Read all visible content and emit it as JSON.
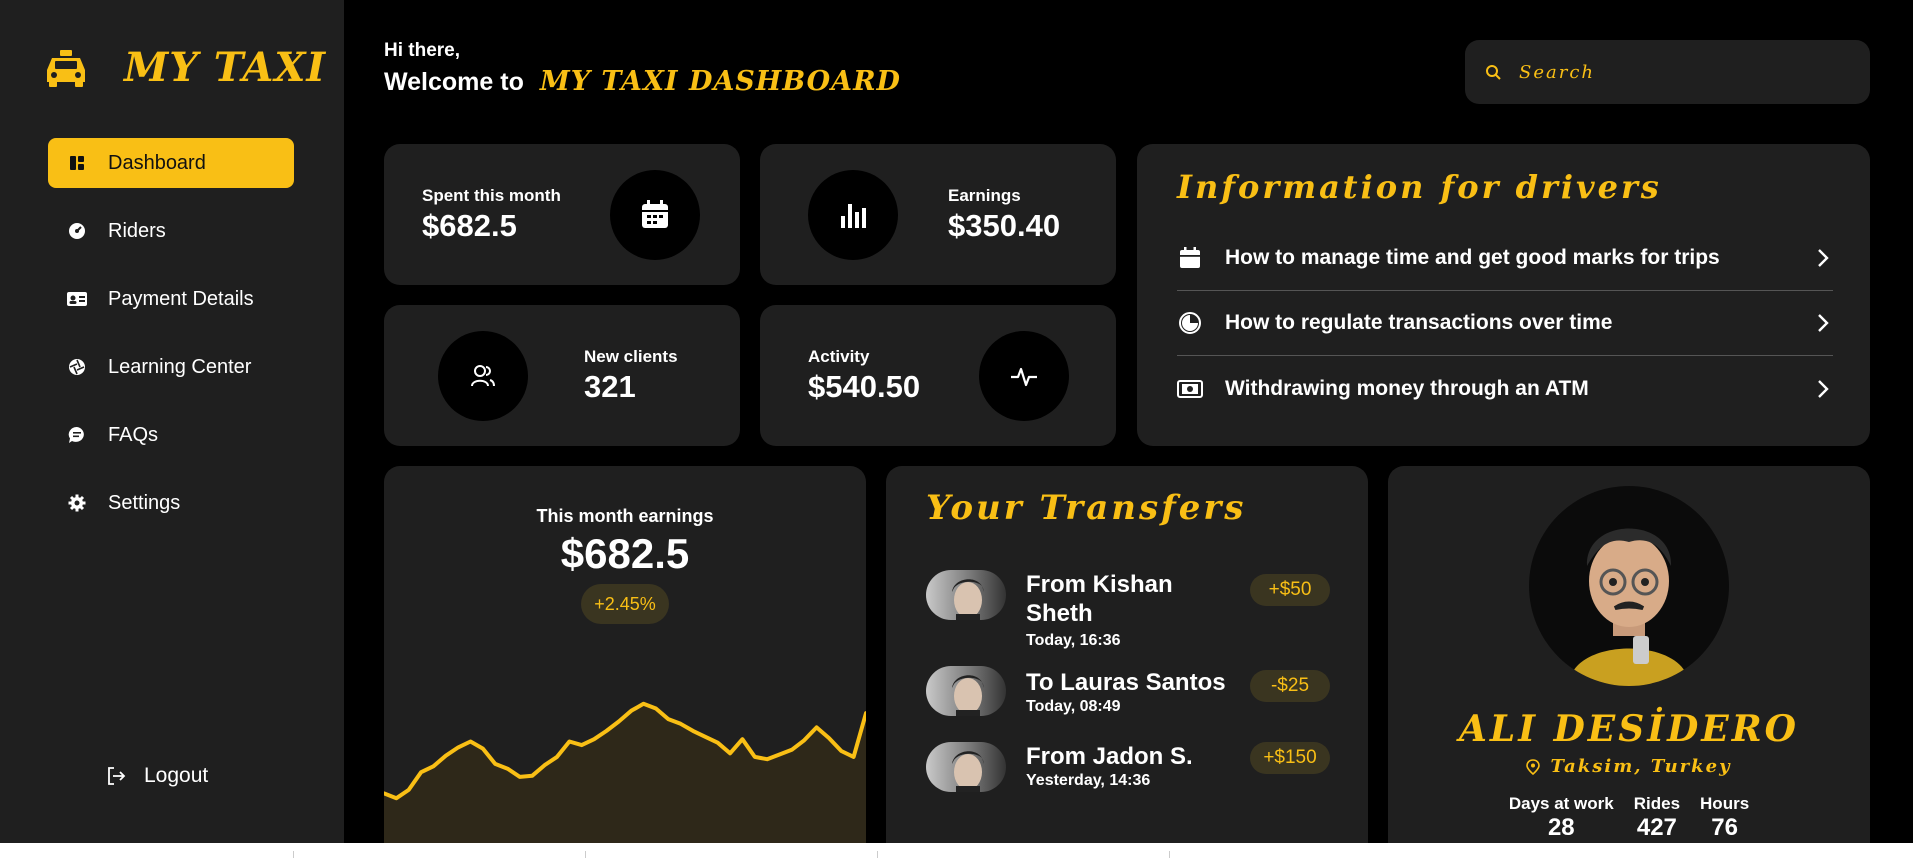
{
  "app": {
    "logo": "MY TAXI",
    "accent": "#f9bf15"
  },
  "sidebar": {
    "items": [
      {
        "label": "Dashboard",
        "icon": "dashboard-icon",
        "active": true
      },
      {
        "label": "Riders",
        "icon": "gauge-icon"
      },
      {
        "label": "Payment Details",
        "icon": "id-card-icon"
      },
      {
        "label": "Learning Center",
        "icon": "aperture-icon"
      },
      {
        "label": "FAQs",
        "icon": "chat-icon"
      },
      {
        "label": "Settings",
        "icon": "gear-icon"
      }
    ],
    "logout": "Logout"
  },
  "header": {
    "greeting": "Hi there,",
    "welcome": "Welcome to",
    "title": "MY TAXI DASHBOARD",
    "search_placeholder": "Search"
  },
  "stats": {
    "spent": {
      "label": "Spent this month",
      "value": "$682.5"
    },
    "earnings": {
      "label": "Earnings",
      "value": "$350.40"
    },
    "clients": {
      "label": "New clients",
      "value": "321"
    },
    "activity": {
      "label": "Activity",
      "value": "$540.50"
    }
  },
  "info": {
    "title": "Information for drivers",
    "items": [
      {
        "text": "How to manage time and get good marks for trips",
        "icon": "calendar-icon"
      },
      {
        "text": "How to regulate transactions over time",
        "icon": "clock-icon"
      },
      {
        "text": "Withdrawing money through an ATM",
        "icon": "cash-icon"
      }
    ]
  },
  "earnings_card": {
    "label": "This month earnings",
    "value": "$682.5",
    "change": "+2.45%"
  },
  "chart_data": {
    "type": "area",
    "title": "This month earnings",
    "xlabel": "",
    "ylabel": "",
    "grid": false,
    "legend": "none",
    "x": [
      0,
      1,
      2,
      3,
      4,
      5,
      6,
      7,
      8,
      9,
      10,
      11,
      12,
      13,
      14,
      15,
      16,
      17,
      18,
      19,
      20,
      21,
      22,
      23,
      24,
      25,
      26,
      27,
      28,
      29,
      30,
      31,
      32,
      33,
      34,
      35,
      36,
      37,
      38,
      39
    ],
    "values": [
      42,
      38,
      45,
      60,
      65,
      74,
      81,
      86,
      80,
      67,
      63,
      56,
      57,
      66,
      73,
      86,
      83,
      88,
      95,
      103,
      112,
      118,
      114,
      105,
      101,
      95,
      90,
      85,
      76,
      88,
      73,
      71,
      75,
      79,
      87,
      98,
      89,
      78,
      73,
      110
    ],
    "ylim": [
      0,
      150
    ],
    "color": "#f9bf15"
  },
  "transfers": {
    "title": "Your Transfers",
    "items": [
      {
        "name": "From Kishan Sheth",
        "time": "Today, 16:36",
        "amount": "+$50"
      },
      {
        "name": "To Lauras Santos",
        "time": "Today, 08:49",
        "amount": "-$25"
      },
      {
        "name": "From Jadon S.",
        "time": "Yesterday, 14:36",
        "amount": "+$150"
      }
    ]
  },
  "profile": {
    "name": "ALI DESİDERO",
    "location": "Taksim, Turkey",
    "stats": [
      {
        "label": "Days at work",
        "value": "28"
      },
      {
        "label": "Rides",
        "value": "427"
      },
      {
        "label": "Hours",
        "value": "76"
      }
    ]
  }
}
